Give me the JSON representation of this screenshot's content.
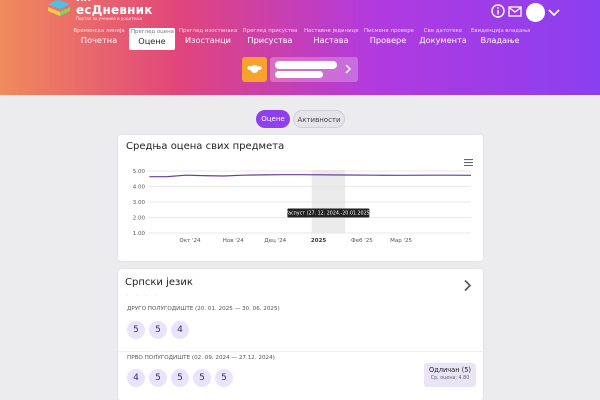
{
  "brand": {
    "top": "ИП",
    "name": "есДневник",
    "subtitle": "Портал за ученике и родитеље"
  },
  "header_icons": [
    "info-icon",
    "mail-icon",
    "avatar",
    "chevron-down-icon"
  ],
  "nav": {
    "items": [
      {
        "caption": "Временска линија",
        "label": "Почетна",
        "active": false
      },
      {
        "caption": "Преглед оцена",
        "label": "Оцене",
        "active": true
      },
      {
        "caption": "Преглед изостанака",
        "label": "Изостанци",
        "active": false
      },
      {
        "caption": "Преглед присуства",
        "label": "Присуства",
        "active": false
      },
      {
        "caption": "Наставне јединице",
        "label": "Настава",
        "active": false
      },
      {
        "caption": "Писмене провере",
        "label": "Провере",
        "active": false
      },
      {
        "caption": "Све датотеке",
        "label": "Документа",
        "active": false
      },
      {
        "caption": "Евиденција владања",
        "label": "Владање",
        "active": false
      }
    ]
  },
  "toggle": {
    "grades_label": "Оцене",
    "activities_label": "Активности",
    "active": "grades"
  },
  "chart_card": {
    "title": "Средња оцена свих предмета"
  },
  "chart_data": {
    "type": "line",
    "title": "Средња оцена свих предмета",
    "xlabel": "",
    "ylabel": "",
    "ylim": [
      1.0,
      5.0
    ],
    "yticks": [
      "5.00",
      "4.00",
      "3.00",
      "2.00",
      "1.00"
    ],
    "x_ticks": [
      "Окт '24",
      "Нов '24",
      "Дец '24",
      "2025",
      "Феб '25",
      "Мар '25"
    ],
    "x_range": [
      "2024-09-01",
      "2025-04-20"
    ],
    "grid": true,
    "color": "#6a3c9e",
    "band": {
      "label": "Распуст (27. 12. 2024.-20.01.2025)",
      "start": "2024-12-27",
      "end": "2025-01-20",
      "color": "#ebebeb"
    },
    "series": [
      {
        "x": [
          "2024-09-02",
          "2024-09-15",
          "2024-09-28",
          "2024-10-10",
          "2024-10-25",
          "2024-11-08",
          "2024-11-22",
          "2024-12-05",
          "2024-12-20",
          "2025-01-20",
          "2025-02-10",
          "2025-03-01",
          "2025-03-20",
          "2025-04-05",
          "2025-04-20"
        ],
        "values": [
          4.63,
          4.64,
          4.73,
          4.7,
          4.68,
          4.73,
          4.75,
          4.76,
          4.76,
          4.74,
          4.73,
          4.72,
          4.73,
          4.73,
          4.72
        ]
      }
    ]
  },
  "subject": {
    "name": "Српски језик",
    "dots": "· · · ·",
    "semesters": [
      {
        "label": "ДРУГО ПОЛУГОДИШТЕ (20. 01. 2025 — 30. 06. 2025)",
        "grades": [
          "5",
          "5",
          "4"
        ]
      },
      {
        "label": "ПРВО ПОЛУГОДИШТЕ (02. 09. 2024 — 27.12. 2024)",
        "grades": [
          "4",
          "5",
          "5",
          "5",
          "5"
        ]
      }
    ],
    "final_grade": "Одличан (5)",
    "average": "Ср. оцена: 4.80"
  },
  "colors": {
    "accent": "#8f3fee",
    "grade_bg": "#e9e4fb",
    "student_icon": "#f8a12f",
    "line": "#6a3c9e"
  }
}
